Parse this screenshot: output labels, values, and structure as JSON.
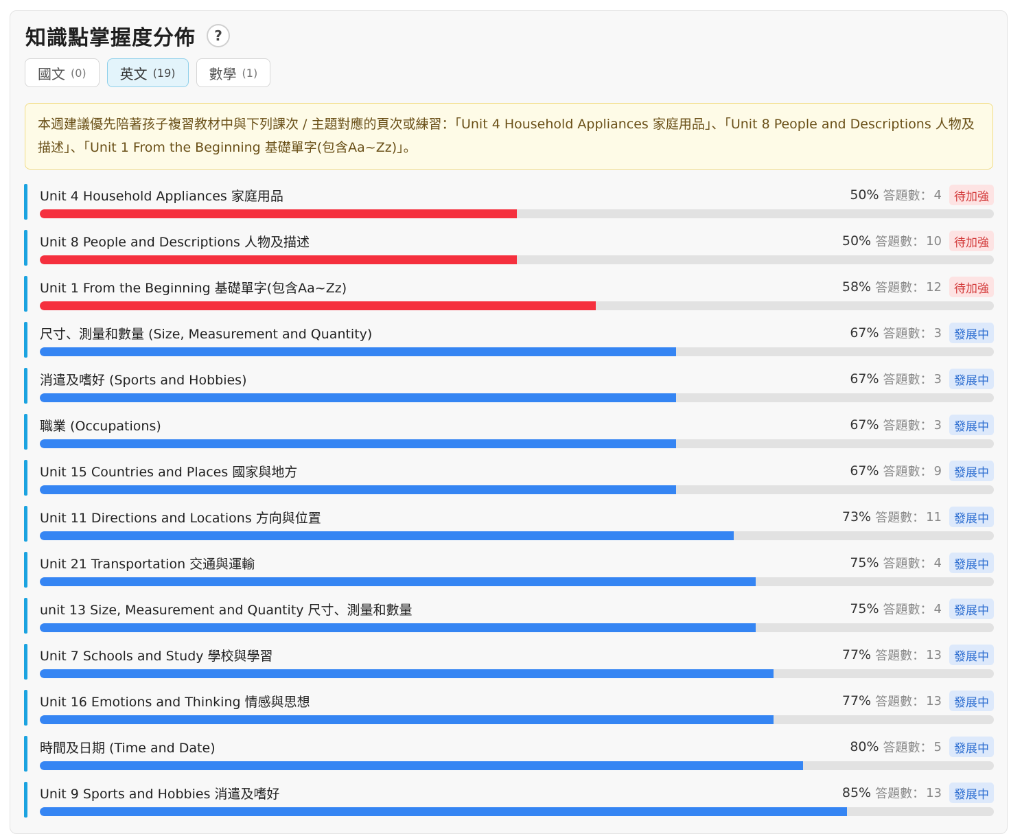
{
  "title": "知識點掌握度分佈",
  "help_label": "?",
  "tabs": [
    {
      "label": "國文",
      "count": "(0)",
      "active": false
    },
    {
      "label": "英文",
      "count": "(19)",
      "active": true
    },
    {
      "label": "數學",
      "count": "(1)",
      "active": false
    }
  ],
  "notice": "本週建議優先陪著孩子複習教材中與下列課次 / 主題對應的頁次或練習：「Unit 4 Household Appliances 家庭用品」、「Unit 8 People and Descriptions 人物及描述」、「Unit 1 From the Beginning 基礎單字(包含Aa~Zz)」。",
  "question_label": "答題數：",
  "colors": {
    "weak": "#f5303e",
    "developing": "#3585f3",
    "accent": "#1ba3e0"
  },
  "topics": [
    {
      "name": "Unit 4 Household Appliances 家庭用品",
      "percent": "50%",
      "value": 0.5,
      "count": "4",
      "status": "待加強",
      "level": "weak"
    },
    {
      "name": "Unit 8 People and Descriptions 人物及描述",
      "percent": "50%",
      "value": 0.5,
      "count": "10",
      "status": "待加強",
      "level": "weak"
    },
    {
      "name": "Unit 1 From the Beginning 基礎單字(包含Aa~Zz)",
      "percent": "58%",
      "value": 0.583,
      "count": "12",
      "status": "待加強",
      "level": "weak"
    },
    {
      "name": "尺寸、測量和數量 (Size, Measurement and Quantity)",
      "percent": "67%",
      "value": 0.667,
      "count": "3",
      "status": "發展中",
      "level": "dev"
    },
    {
      "name": "消遣及嗜好 (Sports and Hobbies)",
      "percent": "67%",
      "value": 0.667,
      "count": "3",
      "status": "發展中",
      "level": "dev"
    },
    {
      "name": "職業 (Occupations)",
      "percent": "67%",
      "value": 0.667,
      "count": "3",
      "status": "發展中",
      "level": "dev"
    },
    {
      "name": "Unit 15 Countries and Places 國家與地方",
      "percent": "67%",
      "value": 0.667,
      "count": "9",
      "status": "發展中",
      "level": "dev"
    },
    {
      "name": "Unit 11 Directions and Locations 方向與位置",
      "percent": "73%",
      "value": 0.727,
      "count": "11",
      "status": "發展中",
      "level": "dev"
    },
    {
      "name": "Unit 21 Transportation 交通與運輸",
      "percent": "75%",
      "value": 0.75,
      "count": "4",
      "status": "發展中",
      "level": "dev"
    },
    {
      "name": "unit 13 Size, Measurement and Quantity 尺寸、測量和數量",
      "percent": "75%",
      "value": 0.75,
      "count": "4",
      "status": "發展中",
      "level": "dev"
    },
    {
      "name": "Unit 7 Schools and Study 學校與學習",
      "percent": "77%",
      "value": 0.769,
      "count": "13",
      "status": "發展中",
      "level": "dev"
    },
    {
      "name": "Unit 16 Emotions and Thinking 情感與思想",
      "percent": "77%",
      "value": 0.769,
      "count": "13",
      "status": "發展中",
      "level": "dev"
    },
    {
      "name": "時間及日期 (Time and Date)",
      "percent": "80%",
      "value": 0.8,
      "count": "5",
      "status": "發展中",
      "level": "dev"
    },
    {
      "name": "Unit 9 Sports and Hobbies 消遣及嗜好",
      "percent": "85%",
      "value": 0.846,
      "count": "13",
      "status": "發展中",
      "level": "dev"
    }
  ]
}
